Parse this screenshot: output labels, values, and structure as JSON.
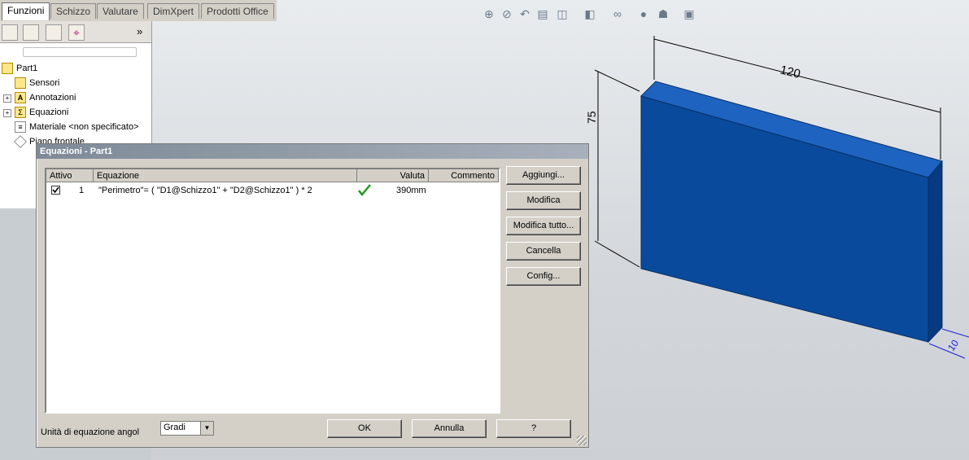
{
  "tabs": [
    {
      "label": "Funzioni",
      "active": true
    },
    {
      "label": "Schizzo",
      "active": false
    },
    {
      "label": "Valutare",
      "active": false
    },
    {
      "label": "DimXpert",
      "active": false
    },
    {
      "label": "Prodotti Office",
      "active": false
    }
  ],
  "panel": {
    "expand_label": "»",
    "tree": [
      {
        "label": "Part1",
        "icon": "part-icon"
      },
      {
        "label": "Sensori",
        "icon": "sensor-icon"
      },
      {
        "label": "Annotazioni",
        "icon": "annotation-icon"
      },
      {
        "label": "Equazioni",
        "icon": "equation-icon"
      },
      {
        "label": "Materiale <non specificato>",
        "icon": "material-icon"
      },
      {
        "label": "Piano frontale",
        "icon": "plane-icon"
      }
    ]
  },
  "dialog": {
    "title": "Equazioni - Part1",
    "columns": [
      "Attivo",
      "Equazione",
      "Valuta",
      "Commento"
    ],
    "rows": [
      {
        "active": true,
        "index": "1",
        "equation": "\"Perimetro\"= ( \"D1@Schizzo1\" + \"D2@Schizzo1\" ) * 2",
        "status_icon": "check-icon",
        "value": "390mm",
        "comment": ""
      }
    ],
    "buttons": {
      "add": "Aggiungi...",
      "edit": "Modifica",
      "edit_all": "Modifica tutto...",
      "delete": "Cancella",
      "config": "Config...",
      "ok": "OK",
      "cancel": "Annulla",
      "help": "?"
    },
    "angle_unit_label": "Unità di equazione angol",
    "angle_unit_value": "Gradi"
  },
  "model": {
    "dimensions": {
      "width": "120",
      "height": "75",
      "depth": "10"
    },
    "color": "#0a4a9c"
  }
}
